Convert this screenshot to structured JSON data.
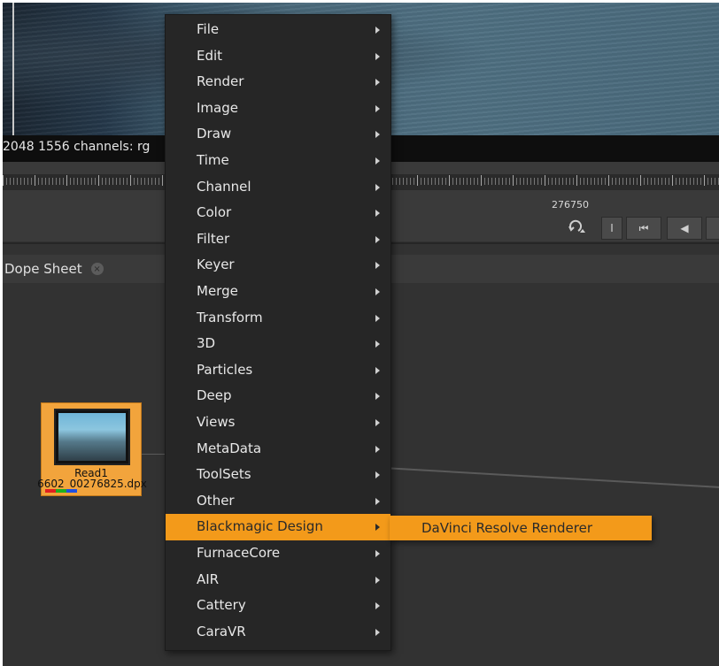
{
  "viewer": {
    "info_text": "2048 1556 channels: rg"
  },
  "timeline": {
    "frame_number": "276750",
    "buttons": [
      "I",
      "⏮",
      "◀"
    ]
  },
  "dope_sheet": {
    "tab_label": "Dope Sheet",
    "close_symbol": "×"
  },
  "node": {
    "name": "Read1",
    "file": "6602_00276825.dpx",
    "channel_colors": [
      "#e02020",
      "#20b020",
      "#2050e0"
    ]
  },
  "menu": {
    "items": [
      "File",
      "Edit",
      "Render",
      "Image",
      "Draw",
      "Time",
      "Channel",
      "Color",
      "Filter",
      "Keyer",
      "Merge",
      "Transform",
      "3D",
      "Particles",
      "Deep",
      "Views",
      "MetaData",
      "ToolSets",
      "Other",
      "Blackmagic Design",
      "FurnaceCore",
      "AIR",
      "Cattery",
      "CaraVR"
    ],
    "active_item": "Blackmagic Design",
    "highlight_color": "#f39a1a"
  },
  "submenu": {
    "items": [
      "DaVinci Resolve Renderer"
    ]
  }
}
